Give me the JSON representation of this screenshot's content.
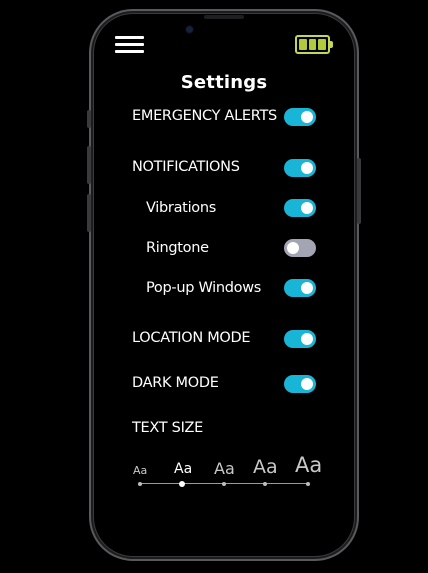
{
  "header": {
    "title": "Settings",
    "battery_color": "#b2c93e"
  },
  "settings": [
    {
      "label": "EMERGENCY ALERTS",
      "on": true
    },
    {
      "label": "NOTIFICATIONS",
      "on": true
    },
    {
      "label": "Vibrations",
      "on": true
    },
    {
      "label": "Ringtone",
      "on": false
    },
    {
      "label": "Pop-up Windows",
      "on": true
    },
    {
      "label": "LOCATION MODE",
      "on": true
    },
    {
      "label": "DARK MODE",
      "on": true
    }
  ],
  "text_size": {
    "label": "TEXT SIZE",
    "samples": [
      "Aa",
      "Aa",
      "Aa",
      "Aa",
      "Aa"
    ],
    "selected_index": 1
  },
  "colors": {
    "toggle_on": "#19b5d6",
    "toggle_off": "#a3a5b4",
    "background": "#000000"
  },
  "icons": {
    "menu": "hamburger-menu-icon",
    "battery": "battery-full-icon"
  }
}
